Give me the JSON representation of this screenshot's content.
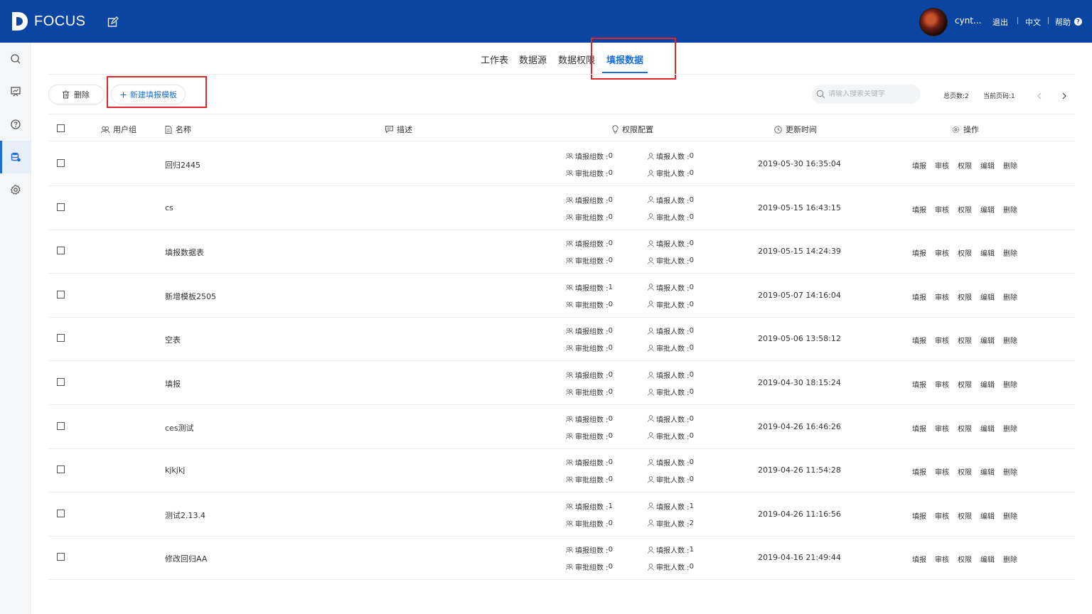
{
  "header": {
    "logo_text": "FOCUS",
    "user": "cynt...",
    "logout": "退出",
    "language": "中文",
    "help": "帮助",
    "help_symbol": "?"
  },
  "tabs": [
    {
      "label": "工作表",
      "active": false
    },
    {
      "label": "数据源",
      "active": false
    },
    {
      "label": "数据权限",
      "active": false
    },
    {
      "label": "填报数据",
      "active": true
    }
  ],
  "toolbar": {
    "delete_label": "删除",
    "new_template_label": "新建填报模板",
    "search_placeholder": "请输入搜索关键字",
    "total_pages": "总页数:2",
    "current_page": "当前页码:1"
  },
  "columns": {
    "group": "用户组",
    "name": "名称",
    "desc": "描述",
    "perm": "权限配置",
    "updated": "更新时间",
    "ops": "操作"
  },
  "perm_labels": {
    "fill_groups": "填报组数 : ",
    "approve_groups": "审批组数 : ",
    "fill_users": "填报人数 : ",
    "approve_users": "审批人数 : "
  },
  "ops": [
    "填报",
    "审核",
    "权限",
    "编辑",
    "删除"
  ],
  "rows": [
    {
      "name": "回归2445",
      "fill_groups": "0",
      "approve_groups": "0",
      "fill_users": "0",
      "approve_users": "0",
      "updated": "2019-05-30 16:35:04"
    },
    {
      "name": "cs",
      "fill_groups": "0",
      "approve_groups": "0",
      "fill_users": "0",
      "approve_users": "0",
      "updated": "2019-05-15 16:43:15"
    },
    {
      "name": "填报数据表",
      "fill_groups": "0",
      "approve_groups": "0",
      "fill_users": "0",
      "approve_users": "0",
      "updated": "2019-05-15 14:24:39"
    },
    {
      "name": "新增模板2505",
      "fill_groups": "1",
      "approve_groups": "0",
      "fill_users": "0",
      "approve_users": "0",
      "updated": "2019-05-07 14:16:04"
    },
    {
      "name": "空表",
      "fill_groups": "0",
      "approve_groups": "0",
      "fill_users": "0",
      "approve_users": "0",
      "updated": "2019-05-06 13:58:12"
    },
    {
      "name": "填报",
      "fill_groups": "0",
      "approve_groups": "0",
      "fill_users": "0",
      "approve_users": "0",
      "updated": "2019-04-30 18:15:24"
    },
    {
      "name": "ces测试",
      "fill_groups": "0",
      "approve_groups": "0",
      "fill_users": "0",
      "approve_users": "0",
      "updated": "2019-04-26 16:46:26"
    },
    {
      "name": "kjkjkj",
      "fill_groups": "0",
      "approve_groups": "0",
      "fill_users": "0",
      "approve_users": "0",
      "updated": "2019-04-26 11:54:28"
    },
    {
      "name": "测试2.13.4",
      "fill_groups": "1",
      "approve_groups": "0",
      "fill_users": "1",
      "approve_users": "2",
      "updated": "2019-04-26 11:16:56"
    },
    {
      "name": "修改回归AA",
      "fill_groups": "0",
      "approve_groups": "0",
      "fill_users": "1",
      "approve_users": "0",
      "updated": "2019-04-16 21:49:44"
    }
  ],
  "colors": {
    "header_bg": "#0a45a1",
    "accent": "#1b6ed6",
    "annotation": "#e0242a"
  },
  "sidebar_icons": [
    "search-icon",
    "dashboard-icon",
    "help-icon",
    "database-icon",
    "settings-icon"
  ]
}
